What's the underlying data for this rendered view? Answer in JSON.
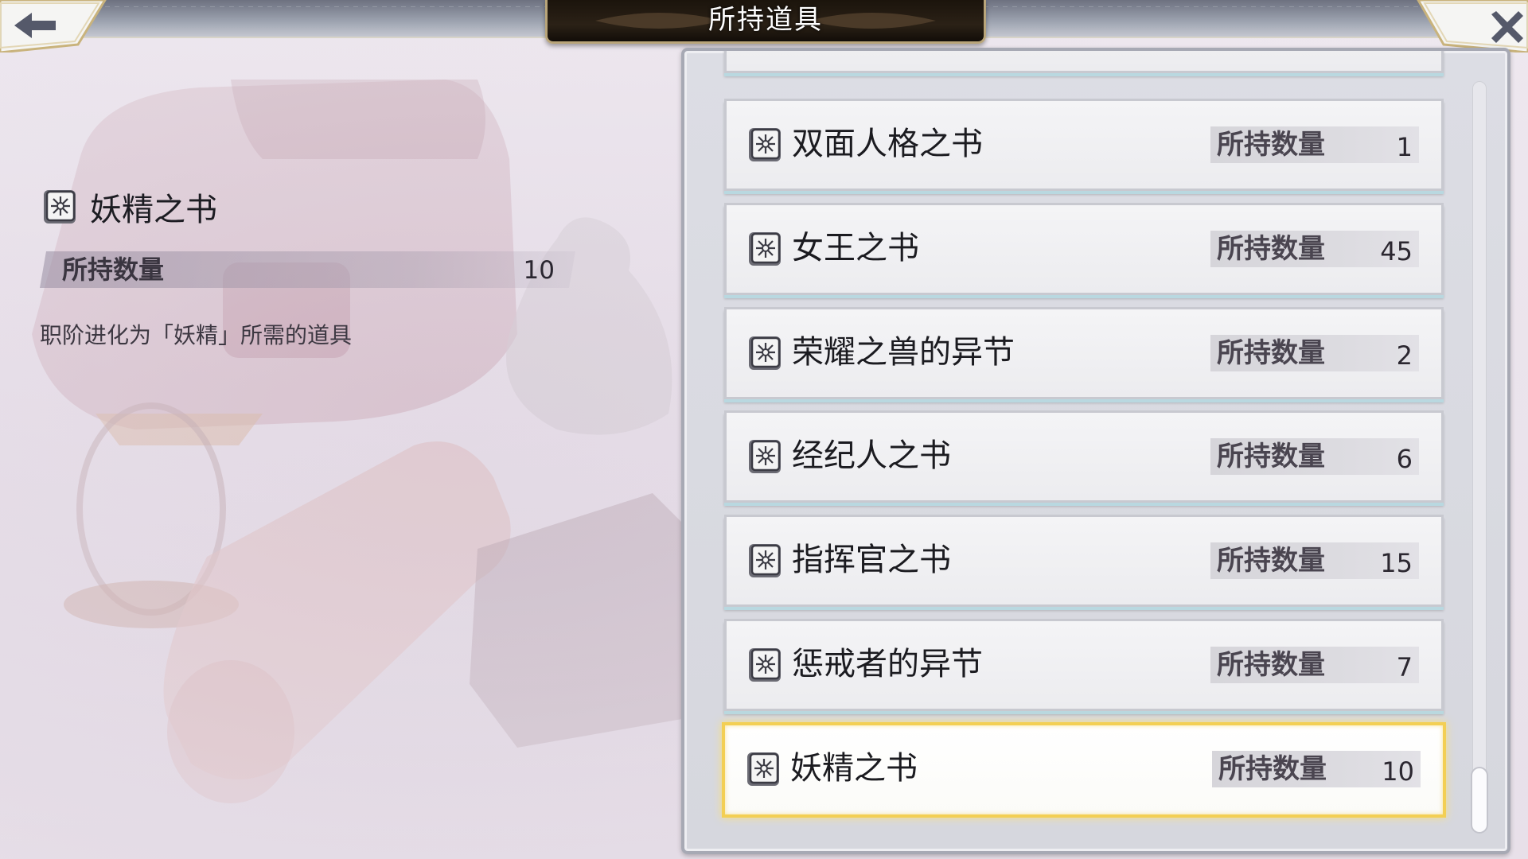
{
  "header": {
    "title": "所持道具"
  },
  "detail": {
    "name": "妖精之书",
    "count_label": "所持数量",
    "count_value": "10",
    "description": "职阶进化为「妖精」所需的道具"
  },
  "items": [
    {
      "name": "双面人格之书",
      "count_label": "所持数量",
      "count": "1",
      "selected": false
    },
    {
      "name": "女王之书",
      "count_label": "所持数量",
      "count": "45",
      "selected": false
    },
    {
      "name": "荣耀之兽的异节",
      "count_label": "所持数量",
      "count": "2",
      "selected": false
    },
    {
      "name": "经纪人之书",
      "count_label": "所持数量",
      "count": "6",
      "selected": false
    },
    {
      "name": "指挥官之书",
      "count_label": "所持数量",
      "count": "15",
      "selected": false
    },
    {
      "name": "惩戒者的异节",
      "count_label": "所持数量",
      "count": "7",
      "selected": false
    },
    {
      "name": "妖精之书",
      "count_label": "所持数量",
      "count": "10",
      "selected": true
    }
  ],
  "colors": {
    "selected_border": "#f3cf54",
    "title_plate": "#1b140c",
    "row_accent": "#b9d8e0"
  },
  "icons": {
    "back": "arrow-left-icon",
    "close": "close-icon",
    "item": "book-icon"
  }
}
